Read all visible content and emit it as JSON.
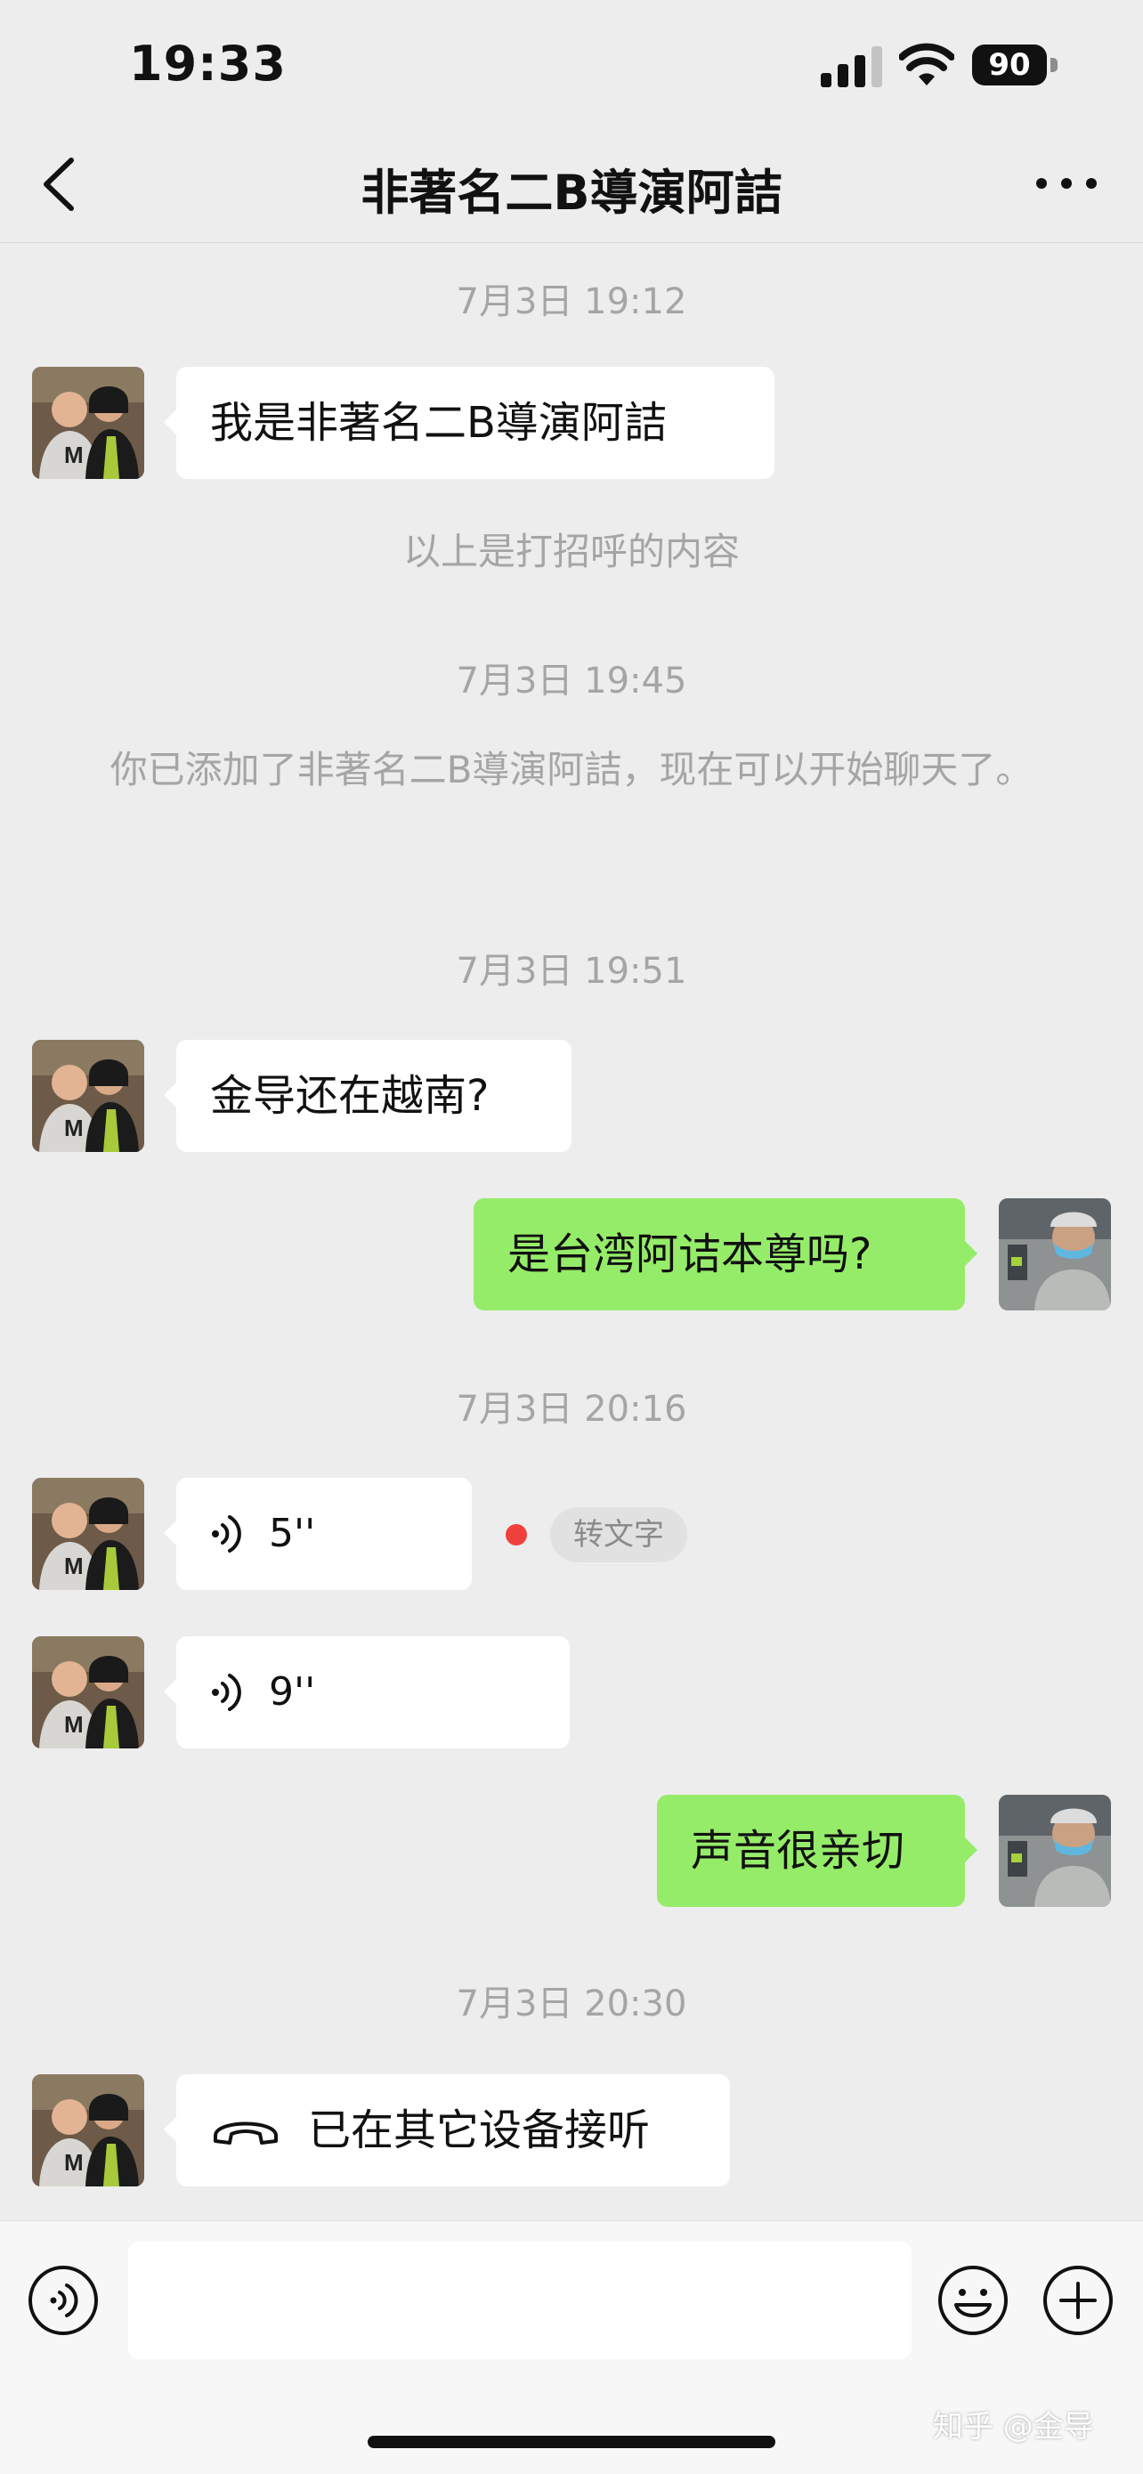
{
  "status": {
    "time": "19:33",
    "battery": "90"
  },
  "nav": {
    "title": "非著名二B導演阿詰"
  },
  "messages": {
    "ts1": "7月3日 19:12",
    "greet": "我是非著名二B導演阿詰",
    "sys_greet": "以上是打招呼的内容",
    "ts2": "7月3日 19:45",
    "sys_added": "你已添加了非著名二B導演阿詰，现在可以开始聊天了。",
    "ts3": "7月3日 19:51",
    "msg_jin": "金导还在越南?",
    "msg_me1": "是台湾阿诘本尊吗?",
    "ts4": "7月3日 20:16",
    "voice1": "5''",
    "to_text": "转文字",
    "voice2": "9''",
    "msg_me2": "声音很亲切",
    "ts5": "7月3日 20:30",
    "call": "已在其它设备接听"
  },
  "icons": [
    "chevron-left-icon",
    "more-icon",
    "voice-wave-icon",
    "phone-hangup-icon",
    "voice-input-icon",
    "emoji-icon",
    "plus-icon",
    "signal-icon",
    "wifi-icon",
    "battery-icon"
  ],
  "colors": {
    "background": "#ededed",
    "outgoing_bubble": "#95ec69",
    "incoming_bubble": "#ffffff",
    "unread_dot": "#f0403c"
  },
  "watermark": "知乎 @金导"
}
